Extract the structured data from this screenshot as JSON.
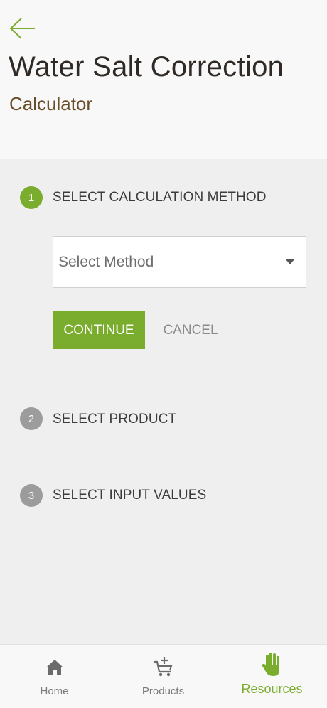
{
  "header": {
    "title": "Water Salt Correction",
    "subtitle": "Calculator",
    "back_icon": "arrow-left-icon"
  },
  "stepper": {
    "steps": [
      {
        "number": "1",
        "label": "SELECT CALCULATION METHOD",
        "state": "active"
      },
      {
        "number": "2",
        "label": "SELECT PRODUCT",
        "state": "inactive"
      },
      {
        "number": "3",
        "label": "SELECT INPUT VALUES",
        "state": "inactive"
      }
    ],
    "method_select": {
      "placeholder": "Select Method"
    },
    "continue_label": "CONTINUE",
    "cancel_label": "CANCEL"
  },
  "nav": {
    "items": [
      {
        "label": "Home",
        "icon": "home-icon"
      },
      {
        "label": "Products",
        "icon": "cart-add-icon"
      },
      {
        "label": "Resources",
        "icon": "hand-icon",
        "active": true
      }
    ]
  },
  "colors": {
    "accent": "#7aac2e",
    "title": "#2f2a26",
    "subtitle": "#6b4f2c",
    "inactive_step": "#9c9c9c"
  }
}
